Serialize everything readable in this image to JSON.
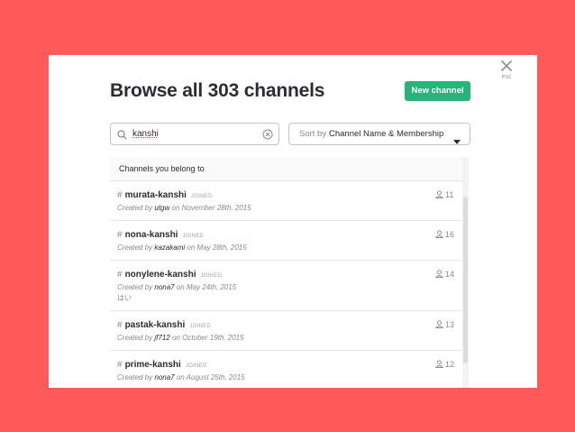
{
  "modal": {
    "title": "Browse all 303 channels",
    "new_channel_label": "New channel",
    "close_hint": "esc"
  },
  "search": {
    "value": "kanshi",
    "placeholder": ""
  },
  "sort": {
    "prefix": "Sort by",
    "value": "Channel Name & Membership"
  },
  "section": {
    "title": "Channels you belong to"
  },
  "channels": [
    {
      "hash": "#",
      "name": "murata-kanshi",
      "status": "JOINED",
      "created_prefix": "Created by",
      "creator": "utgw",
      "created_on": "on November 28th, 2015",
      "purpose": "",
      "members": "11"
    },
    {
      "hash": "#",
      "name": "nona-kanshi",
      "status": "JOINED",
      "created_prefix": "Created by",
      "creator": "kazakami",
      "created_on": "on May 28th, 2015",
      "purpose": "",
      "members": "16"
    },
    {
      "hash": "#",
      "name": "nonylene-kanshi",
      "status": "JOINED",
      "created_prefix": "Created by",
      "creator": "nona7",
      "created_on": "on May 24th, 2015",
      "purpose": "はい",
      "members": "14"
    },
    {
      "hash": "#",
      "name": "pastak-kanshi",
      "status": "JOINED",
      "created_prefix": "Created by",
      "creator": "jf712",
      "created_on": "on October 19th, 2015",
      "purpose": "",
      "members": "13"
    },
    {
      "hash": "#",
      "name": "prime-kanshi",
      "status": "JOINED",
      "created_prefix": "Created by",
      "creator": "nona7",
      "created_on": "on August 25th, 2015",
      "purpose": "",
      "members": "12"
    }
  ],
  "colors": {
    "backdrop": "#ff5a5a",
    "primary_button": "#2ab27b",
    "text": "#2c2d30",
    "muted": "#8a8a8a"
  }
}
